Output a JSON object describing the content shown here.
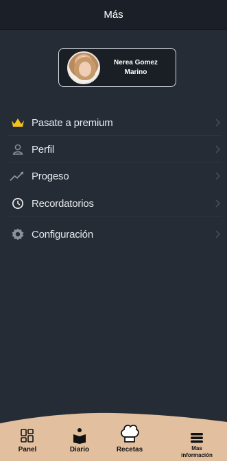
{
  "header": {
    "title": "Más"
  },
  "profile": {
    "name_line1": "Nerea Gomez",
    "name_line2": "Marino"
  },
  "menu": {
    "items": [
      {
        "label": "Pasate a premium",
        "icon": "crown-icon"
      },
      {
        "label": "Perfil",
        "icon": "user-icon"
      },
      {
        "label": "Progeso",
        "icon": "trend-up-icon"
      },
      {
        "label": "Recordatorios",
        "icon": "clock-icon"
      },
      {
        "label": "Configuración",
        "icon": "gear-icon"
      }
    ]
  },
  "nav": {
    "items": [
      {
        "label": "Panel",
        "icon": "dashboard-icon"
      },
      {
        "label": "Diario",
        "icon": "diary-icon"
      },
      {
        "label": "Recetas",
        "icon": "chef-hat-icon"
      },
      {
        "label_line1": "Mas",
        "label_line2": "información",
        "icon": "menu-icon"
      }
    ]
  },
  "colors": {
    "background": "#252c36",
    "header": "#1b2028",
    "nav_background": "#e2bf9f",
    "crown": "#f2c31b"
  }
}
